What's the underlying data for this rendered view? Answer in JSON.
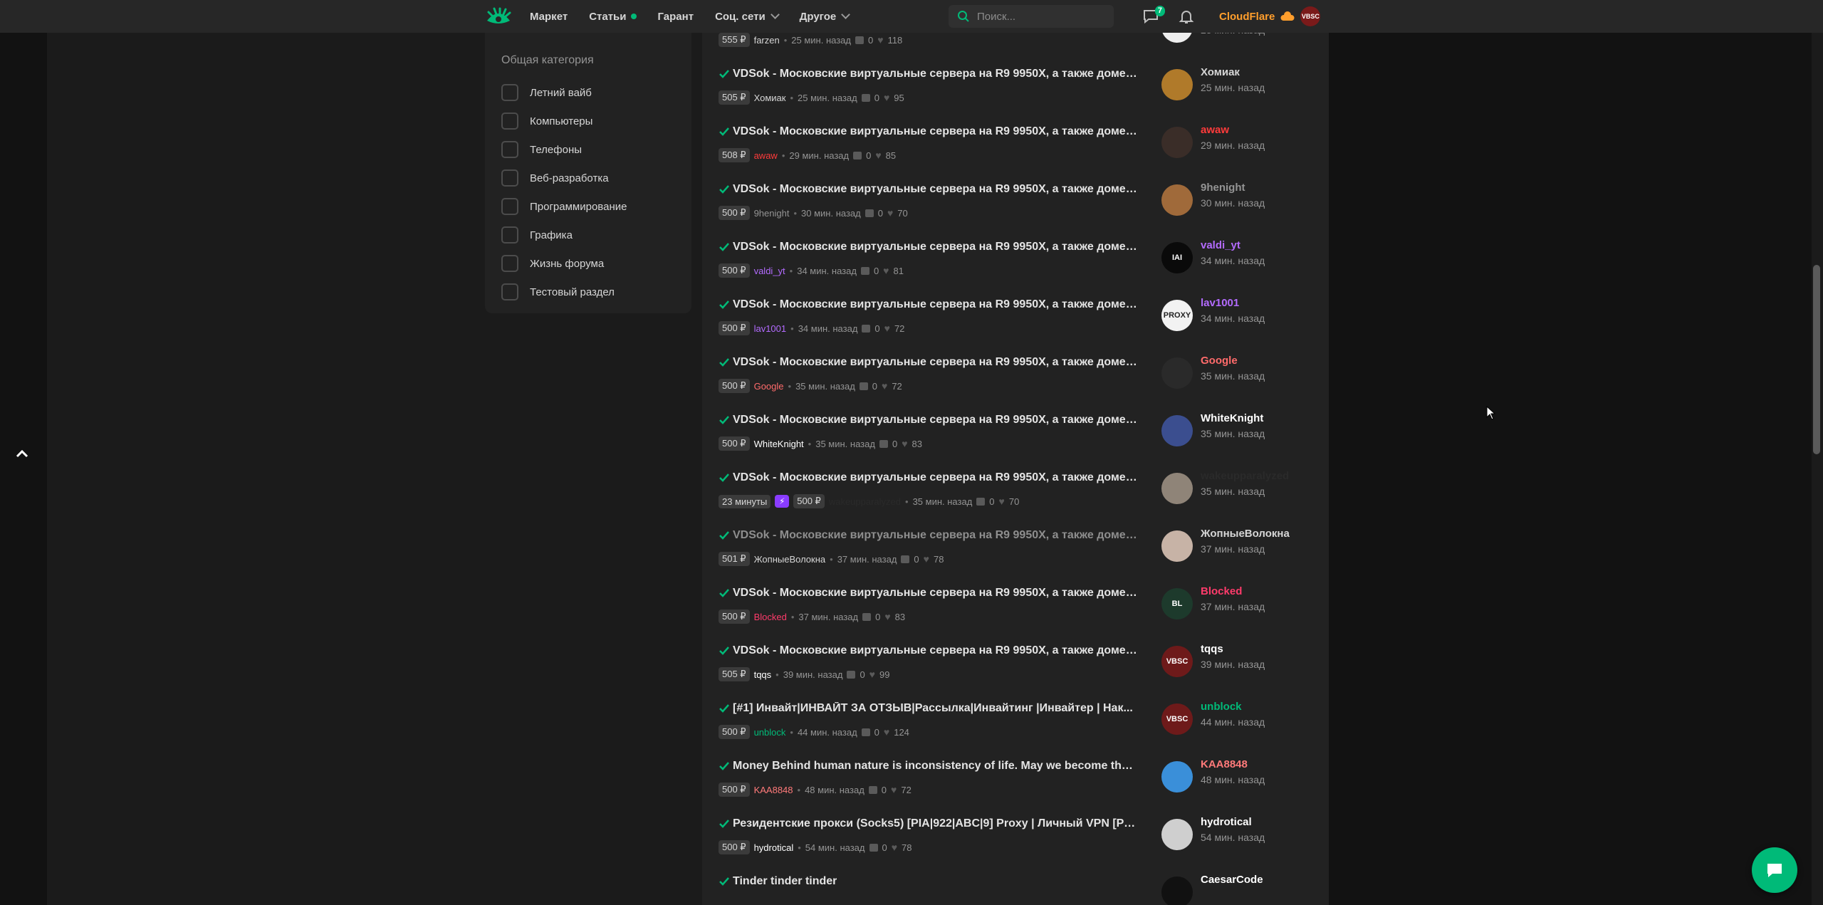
{
  "header": {
    "nav": [
      {
        "label": "Маркет",
        "dot": false,
        "dropdown": false
      },
      {
        "label": "Статьи",
        "dot": true,
        "dropdown": false
      },
      {
        "label": "Гарант",
        "dot": false,
        "dropdown": false
      },
      {
        "label": "Соц. сети",
        "dot": false,
        "dropdown": true
      },
      {
        "label": "Другое",
        "dot": false,
        "dropdown": true
      }
    ],
    "search_placeholder": "Поиск...",
    "messages_count": "7",
    "username": "CloudFlare",
    "avatar_text": "VBSC"
  },
  "sidebar": {
    "heading": "Общая категория",
    "items": [
      "Летний вайб",
      "Компьютеры",
      "Телефоны",
      "Веб-разработка",
      "Программирование",
      "Графика",
      "Жизнь форума",
      "Тестовый раздел"
    ]
  },
  "threads": [
    {
      "title": "VDSok - Московские виртуальные сервера на R9 9950X, а также домены ...",
      "price": "555 ₽",
      "author": "farzen",
      "author_color": "#d6d6d6",
      "time": "25 мин. назад",
      "replies": "0",
      "likes": "118",
      "last_user": "farzen",
      "last_color": "#d6d6d6",
      "last_time": "25 мин. назад",
      "avatar": "",
      "avatar_bg": "#eeeeee"
    },
    {
      "title": "VDSok - Московские виртуальные сервера на R9 9950X, а также домены ...",
      "price": "505 ₽",
      "author": "Хомиак",
      "author_color": "#d6d6d6",
      "time": "25 мин. назад",
      "replies": "0",
      "likes": "95",
      "last_user": "Хомиак",
      "last_color": "#d6d6d6",
      "last_time": "25 мин. назад",
      "avatar": "",
      "avatar_bg": "#b07a2a"
    },
    {
      "title": "VDSok - Московские виртуальные сервера на R9 9950X, а также домены ...",
      "price": "508 ₽",
      "author": "awaw",
      "author_color": "#ff3b3b",
      "time": "29 мин. назад",
      "replies": "0",
      "likes": "85",
      "last_user": "awaw",
      "last_color": "#ff3b3b",
      "last_time": "29 мин. назад",
      "avatar": "",
      "avatar_bg": "#3a2d28"
    },
    {
      "title": "VDSok - Московские виртуальные сервера на R9 9950X, а также домены ...",
      "price": "500 ₽",
      "author": "9henight",
      "author_color": "#949494",
      "time": "30 мин. назад",
      "replies": "0",
      "likes": "70",
      "last_user": "9henight",
      "last_color": "#949494",
      "last_time": "30 мин. назад",
      "avatar": "",
      "avatar_bg": "#a06a3a"
    },
    {
      "title": "VDSok - Московские виртуальные сервера на R9 9950X, а также домены ...",
      "price": "500 ₽",
      "author": "valdi_yt",
      "author_color": "#b36bff",
      "time": "34 мин. назад",
      "replies": "0",
      "likes": "81",
      "last_user": "valdi_yt",
      "last_color": "#b36bff",
      "last_time": "34 мин. назад",
      "avatar": "IAI",
      "avatar_bg": "#0a0a0a"
    },
    {
      "title": "VDSok - Московские виртуальные сервера на R9 9950X, а также домены ...",
      "price": "500 ₽",
      "author": "lav1001",
      "author_color": "#b36bff",
      "time": "34 мин. назад",
      "replies": "0",
      "likes": "72",
      "last_user": "lav1001",
      "last_color": "#b36bff",
      "last_time": "34 мин. назад",
      "avatar": "PROXY",
      "avatar_bg": "#f2f2f2"
    },
    {
      "title": "VDSok - Московские виртуальные сервера на R9 9950X, а также домены ...",
      "price": "500 ₽",
      "author": "Google",
      "author_color": "#ff6b6b",
      "time": "35 мин. назад",
      "replies": "0",
      "likes": "72",
      "last_user": "Google",
      "last_color": "#ff6b6b",
      "last_time": "35 мин. назад",
      "avatar": "",
      "avatar_bg": "#2a2a2a"
    },
    {
      "title": "VDSok - Московские виртуальные сервера на R9 9950X, а также домены ...",
      "price": "500 ₽",
      "author": "WhiteKnight",
      "author_color": "#ffffff",
      "time": "35 мин. назад",
      "replies": "0",
      "likes": "83",
      "last_user": "WhiteKnight",
      "last_color": "#ffffff",
      "last_time": "35 мин. назад",
      "avatar": "",
      "avatar_bg": "#3b4e8f"
    },
    {
      "title": "VDSok - Московские виртуальные сервера на R9 9950X, а также домены ...",
      "price": "500 ₽",
      "boost_time": "23 минуты",
      "author": "wakeupparalyzed",
      "author_color": "#2a2a2a",
      "time": "35 мин. назад",
      "replies": "0",
      "likes": "70",
      "last_user": "wakeupparalyzed",
      "last_color": "#2a2a2a",
      "last_time": "35 мин. назад",
      "avatar": "",
      "avatar_bg": "#8f8478"
    },
    {
      "title": "VDSok - Московские виртуальные сервера на R9 9950X, а также домены ...",
      "price": "501 ₽",
      "author": "ЖопныеВолокна",
      "author_color": "#d6d6d6",
      "time": "37 мин. назад",
      "replies": "0",
      "likes": "78",
      "last_user": "ЖопныеВолокна",
      "last_color": "#d6d6d6",
      "last_time": "37 мин. назад",
      "avatar": "",
      "avatar_bg": "#c7b3a6",
      "dim": true
    },
    {
      "title": "VDSok - Московские виртуальные сервера на R9 9950X, а также домены ...",
      "price": "500 ₽",
      "author": "Blocked",
      "author_color": "#ff3b6b",
      "time": "37 мин. назад",
      "replies": "0",
      "likes": "83",
      "last_user": "Blocked",
      "last_color": "#ff3b6b",
      "last_time": "37 мин. назад",
      "avatar": "BL",
      "avatar_bg": "#1d3a2c"
    },
    {
      "title": "VDSok - Московские виртуальные сервера на R9 9950X, а также домены ...",
      "price": "505 ₽",
      "author": "tqqs",
      "author_color": "#ffffff",
      "time": "39 мин. назад",
      "replies": "0",
      "likes": "99",
      "last_user": "tqqs",
      "last_color": "#ffffff",
      "last_time": "39 мин. назад",
      "avatar": "VBSC",
      "avatar_bg": "#6e1a1a"
    },
    {
      "title": "[#1] Инвайт|ИНВАЙТ ЗА ОТЗЫВ|Рассылка|Инвайтинг |Инвайтер | Нак...",
      "price": "500 ₽",
      "author": "unblock",
      "author_color": "#00ba78",
      "time": "44 мин. назад",
      "replies": "0",
      "likes": "124",
      "last_user": "unblock",
      "last_color": "#00ba78",
      "last_time": "44 мин. назад",
      "avatar": "VBSC",
      "avatar_bg": "#6e1a1a"
    },
    {
      "title": "Money Behind human nature is inconsistency of life. May we become the m...",
      "price": "500 ₽",
      "author": "KAA8848",
      "author_color": "#ff7a7a",
      "time": "48 мин. назад",
      "replies": "0",
      "likes": "72",
      "last_user": "KAA8848",
      "last_color": "#ff7a7a",
      "last_time": "48 мин. назад",
      "avatar": "",
      "avatar_bg": "#3a8fd9"
    },
    {
      "title": "Резидентские прокси (Socks5) [PIA|922|ABC|9] Proxy | Личный VPN [Раб...",
      "price": "500 ₽",
      "author": "hydrotical",
      "author_color": "#ffffff",
      "time": "54 мин. назад",
      "replies": "0",
      "likes": "78",
      "last_user": "hydrotical",
      "last_color": "#ffffff",
      "last_time": "54 мин. назад",
      "avatar": "",
      "avatar_bg": "#cfcfcf"
    },
    {
      "title": "Tinder tinder tinder",
      "price": "",
      "author": "",
      "author_color": "#d6d6d6",
      "time": "",
      "replies": "",
      "likes": "",
      "last_user": "CaesarCode",
      "last_color": "#ffffff",
      "last_time": "",
      "avatar": "",
      "avatar_bg": "#111"
    }
  ],
  "colors": {
    "accent": "#00ba78",
    "brand_orange": "#ff9e2c"
  }
}
